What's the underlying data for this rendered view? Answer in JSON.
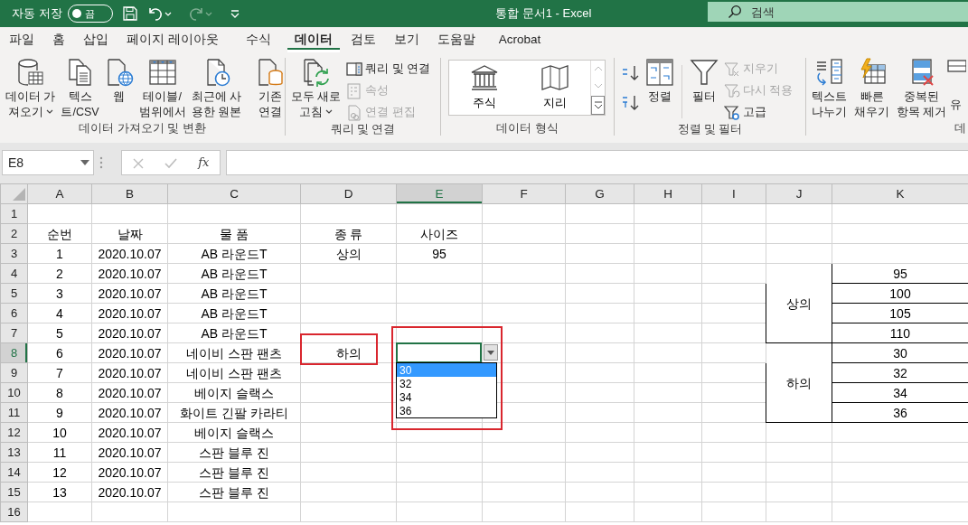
{
  "title_bar": {
    "autosave_label": "자동 저장",
    "autosave": {
      "label": "끔",
      "on": false
    },
    "quick_access": [
      {
        "kind": "save"
      },
      {
        "kind": "undo"
      },
      {
        "kind": "redo",
        "disabled": true
      },
      {
        "kind": "customize"
      }
    ],
    "title": "통합 문서1  -  Excel",
    "search": {
      "placeholder": "검색"
    }
  },
  "tabs": [
    {
      "label": "파일",
      "selected": false
    },
    {
      "label": "홈",
      "selected": false
    },
    {
      "label": "삽입",
      "selected": false
    },
    {
      "label": "페이지 레이아웃",
      "selected": false
    },
    {
      "label": "수식",
      "selected": false
    },
    {
      "label": "데이터",
      "selected": true
    },
    {
      "label": "검토",
      "selected": false
    },
    {
      "label": "보기",
      "selected": false
    },
    {
      "label": "도움말",
      "selected": false
    },
    {
      "label": "Acrobat",
      "selected": false
    }
  ],
  "ribbon": [
    {
      "label": "데이터 가져오기 및 변환",
      "items": [
        {
          "kind": "large",
          "lines": [
            "데이터 가",
            "져오기"
          ],
          "menu": true
        },
        {
          "kind": "large",
          "lines": [
            "텍스",
            "트/CSV"
          ]
        },
        {
          "kind": "large",
          "lines": [
            "웹"
          ]
        },
        {
          "kind": "large",
          "lines": [
            "테이블/",
            "범위에서"
          ]
        },
        {
          "kind": "large",
          "lines": [
            "최근에 사",
            "용한 원본"
          ]
        },
        {
          "kind": "divider"
        },
        {
          "kind": "large",
          "lines": [
            "기존",
            "연결"
          ]
        }
      ]
    },
    {
      "label": "쿼리 및 연결",
      "items": [
        {
          "kind": "large",
          "lines": [
            "모두 새로",
            "고침"
          ],
          "menu": true
        },
        {
          "kind": "small",
          "lines": [
            "쿼리 및 연결"
          ],
          "disabled": false
        },
        {
          "kind": "small",
          "lines": [
            "속성"
          ],
          "disabled": true
        },
        {
          "kind": "small",
          "lines": [
            "연결 편집"
          ],
          "disabled": true
        }
      ]
    },
    {
      "label": "데이터 형식",
      "items": [
        {
          "kind": "gallery",
          "options": [
            {
              "label": "주식"
            },
            {
              "label": "지리"
            }
          ]
        }
      ]
    },
    {
      "label": "정렬 및 필터",
      "items": [
        {
          "kind": "small"
        },
        {
          "kind": "small"
        },
        {
          "kind": "large",
          "lines": [
            "정렬"
          ]
        },
        {
          "kind": "divider"
        },
        {
          "kind": "large",
          "lines": [
            "필터"
          ]
        },
        {
          "kind": "small",
          "lines": [
            "지우기"
          ],
          "disabled": true
        },
        {
          "kind": "small",
          "lines": [
            "다시 적용"
          ],
          "disabled": true
        },
        {
          "kind": "small",
          "lines": [
            "고급"
          ],
          "disabled": false
        }
      ]
    },
    {
      "label": "데",
      "items": [
        {
          "kind": "large",
          "lines": [
            "텍스트",
            "나누기"
          ]
        },
        {
          "kind": "large",
          "lines": [
            "빠른",
            "채우기"
          ]
        },
        {
          "kind": "large",
          "lines": [
            "중복된",
            "항목 제거"
          ]
        },
        {
          "kind": "large",
          "lines": [
            "유"
          ]
        }
      ]
    }
  ],
  "formula_bar": {
    "name_box": "E8",
    "buttons": [
      {
        "kind": "cancel",
        "disabled": true
      },
      {
        "kind": "enter",
        "disabled": true
      },
      {
        "kind": "function",
        "label": "fx",
        "disabled": false
      }
    ]
  },
  "sheet": {
    "columns": [
      {
        "label": "A",
        "selected": false
      },
      {
        "label": "B",
        "selected": false
      },
      {
        "label": "C",
        "selected": false
      },
      {
        "label": "D",
        "selected": false
      },
      {
        "label": "E",
        "selected": true
      },
      {
        "label": "F",
        "selected": false
      },
      {
        "label": "G",
        "selected": false
      },
      {
        "label": "H",
        "selected": false
      },
      {
        "label": "I",
        "selected": false
      },
      {
        "label": "J",
        "selected": false
      },
      {
        "label": "K",
        "selected": false
      }
    ],
    "rows": [
      {
        "label": "1",
        "selected": false
      },
      {
        "label": "2",
        "selected": false,
        "cells": {
          "A": "순번",
          "B": "날짜",
          "C": "물 품",
          "D": "종 류",
          "E": "사이즈"
        }
      },
      {
        "label": "3",
        "selected": false,
        "cells": {
          "A": "1",
          "B": "2020.10.07",
          "C": "AB 라운드T",
          "D": "상의",
          "E": "95"
        }
      },
      {
        "label": "4",
        "selected": false,
        "cells": {
          "A": "2",
          "B": "2020.10.07",
          "C": "AB 라운드T"
        }
      },
      {
        "label": "5",
        "selected": false,
        "cells": {
          "A": "3",
          "B": "2020.10.07",
          "C": "AB 라운드T"
        }
      },
      {
        "label": "6",
        "selected": false,
        "cells": {
          "A": "4",
          "B": "2020.10.07",
          "C": "AB 라운드T"
        }
      },
      {
        "label": "7",
        "selected": false,
        "cells": {
          "A": "5",
          "B": "2020.10.07",
          "C": "AB 라운드T"
        }
      },
      {
        "label": "8",
        "selected": true,
        "cells": {
          "A": "6",
          "B": "2020.10.07",
          "C": "네이비 스판 팬츠",
          "D": {
            "text": "하의",
            "highlighted": true
          }
        }
      },
      {
        "label": "9",
        "selected": false,
        "cells": {
          "A": "7",
          "B": "2020.10.07",
          "C": "네이비 스판 팬츠"
        }
      },
      {
        "label": "10",
        "selected": false,
        "cells": {
          "A": "8",
          "B": "2020.10.07",
          "C": "베이지 슬랙스"
        }
      },
      {
        "label": "11",
        "selected": false,
        "cells": {
          "A": "9",
          "B": "2020.10.07",
          "C": "화이트 긴팔 카라티"
        }
      },
      {
        "label": "12",
        "selected": false,
        "cells": {
          "A": "10",
          "B": "2020.10.07",
          "C": "베이지 슬랙스"
        }
      },
      {
        "label": "13",
        "selected": false,
        "cells": {
          "A": "11",
          "B": "2020.10.07",
          "C": "스판 블루 진"
        }
      },
      {
        "label": "14",
        "selected": false,
        "cells": {
          "A": "12",
          "B": "2020.10.07",
          "C": "스판 블루 진"
        }
      },
      {
        "label": "15",
        "selected": false,
        "cells": {
          "A": "13",
          "B": "2020.10.07",
          "C": "스판 블루 진"
        }
      },
      {
        "label": "16",
        "selected": false
      }
    ],
    "size_table": [
      {
        "category": "상의",
        "sizes": [
          "95",
          "100",
          "105",
          "110"
        ]
      },
      {
        "category": "하의",
        "sizes": [
          "30",
          "32",
          "34",
          "36"
        ]
      }
    ],
    "dropdown": {
      "highlighted": true,
      "options": [
        {
          "label": "30",
          "selected": true
        },
        {
          "label": "32",
          "selected": false
        },
        {
          "label": "34",
          "selected": false
        },
        {
          "label": "36",
          "selected": false
        }
      ]
    }
  }
}
